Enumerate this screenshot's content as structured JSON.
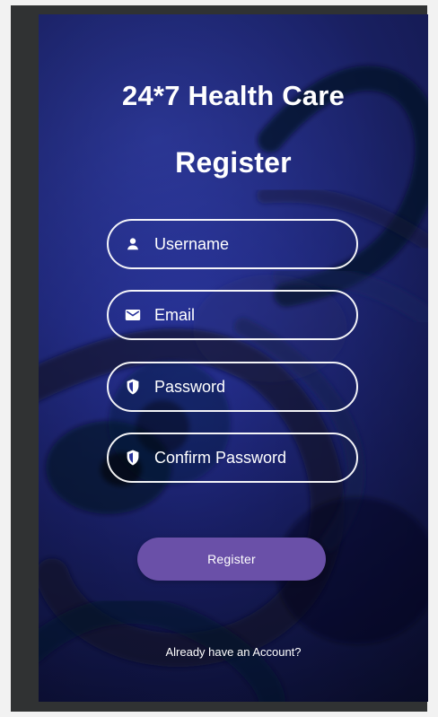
{
  "app_title": "24*7 Health Care",
  "screen_title": "Register",
  "fields": [
    {
      "label": "Username",
      "icon": "user-icon"
    },
    {
      "label": "Email",
      "icon": "mail-icon"
    },
    {
      "label": "Password",
      "icon": "shield-icon"
    },
    {
      "label": "Confirm Password",
      "icon": "shield-icon"
    }
  ],
  "actions": {
    "register_label": "Register",
    "login_link": "Already have an Account?"
  },
  "colors": {
    "background_primary": "#28339b",
    "button_purple": "#6a50a8",
    "field_border": "#ffffff",
    "text": "#ffffff"
  }
}
